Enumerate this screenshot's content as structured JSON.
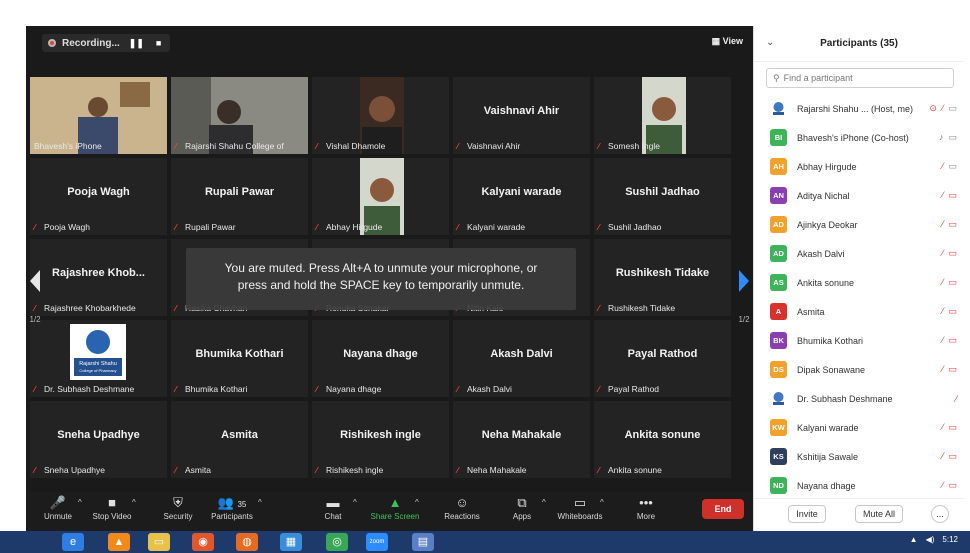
{
  "recording": {
    "label": "Recording...",
    "pause_glyph": "❚❚",
    "stop_glyph": "■"
  },
  "view_label": "View",
  "tiles": [
    {
      "big": "",
      "cap": "Bhavesh's iPhone",
      "photo": "man-room",
      "active": true,
      "muted": false
    },
    {
      "big": "",
      "cap": "Rajarshi Shahu College of",
      "photo": "man-dark",
      "active": false,
      "muted": true
    },
    {
      "big": "",
      "cap": "Vishal Dhamole",
      "photo": "face-dark",
      "active": false,
      "muted": true
    },
    {
      "big": "Vaishnavi Ahir",
      "cap": "Vaishnavi Ahir",
      "photo": "",
      "active": false,
      "muted": true
    },
    {
      "big": "",
      "cap": "Somesh Ingle",
      "photo": "face-light",
      "active": false,
      "muted": true
    },
    {
      "big": "Pooja Wagh",
      "cap": "Pooja Wagh",
      "photo": "",
      "active": false,
      "muted": true
    },
    {
      "big": "Rupali Pawar",
      "cap": "Rupali Pawar",
      "photo": "",
      "active": false,
      "muted": true
    },
    {
      "big": "",
      "cap": "Abhay Hirgude",
      "photo": "face-light",
      "active": false,
      "muted": true
    },
    {
      "big": "Kalyani warade",
      "cap": "Kalyani warade",
      "photo": "",
      "active": false,
      "muted": true
    },
    {
      "big": "Sushil Jadhao",
      "cap": "Sushil Jadhao",
      "photo": "",
      "active": false,
      "muted": true
    },
    {
      "big": "Rajashree Khob...",
      "cap": "Rajashree Khobarkhede",
      "photo": "",
      "active": false,
      "muted": true
    },
    {
      "big": "",
      "cap": "Rasika Chavhan",
      "photo": "",
      "active": false,
      "muted": true
    },
    {
      "big": "",
      "cap": "Renuka Sonakar",
      "photo": "",
      "active": false,
      "muted": true
    },
    {
      "big": "",
      "cap": "Nitin Kale",
      "photo": "",
      "active": false,
      "muted": true
    },
    {
      "big": "Rushikesh Tidake",
      "cap": "Rushikesh Tidake",
      "photo": "",
      "active": false,
      "muted": true
    },
    {
      "big": "",
      "cap": "Dr. Subhash Deshmane",
      "photo": "logo",
      "active": false,
      "muted": true
    },
    {
      "big": "Bhumika Kothari",
      "cap": "Bhumika Kothari",
      "photo": "",
      "active": false,
      "muted": true
    },
    {
      "big": "Nayana dhage",
      "cap": "Nayana dhage",
      "photo": "",
      "active": false,
      "muted": true
    },
    {
      "big": "Akash Dalvi",
      "cap": "Akash Dalvi",
      "photo": "",
      "active": false,
      "muted": true
    },
    {
      "big": "Payal Rathod",
      "cap": "Payal Rathod",
      "photo": "",
      "active": false,
      "muted": true
    },
    {
      "big": "Sneha Upadhye",
      "cap": "Sneha Upadhye",
      "photo": "",
      "active": false,
      "muted": true
    },
    {
      "big": "Asmita",
      "cap": "Asmita",
      "photo": "",
      "active": false,
      "muted": true
    },
    {
      "big": "Rishikesh ingle",
      "cap": "Rishikesh ingle",
      "photo": "",
      "active": false,
      "muted": true
    },
    {
      "big": "Neha Mahakale",
      "cap": "Neha Mahakale",
      "photo": "",
      "active": false,
      "muted": true
    },
    {
      "big": "Ankita sonune",
      "cap": "Ankita sonune",
      "photo": "",
      "active": false,
      "muted": true
    }
  ],
  "logo_text": {
    "line1": "Rajarshi Shahu",
    "line2": "College of Pharmacy"
  },
  "page_indicator": "1/2",
  "toast": {
    "line1": "You are muted. Press Alt+A to unmute your microphone, or",
    "line2": "press and hold the SPACE key to temporarily unmute."
  },
  "toolbar": {
    "items": [
      {
        "label": "Unmute",
        "icon": "mic-muted-icon",
        "glyph": "🎤",
        "caret": true
      },
      {
        "label": "Stop Video",
        "icon": "video-icon",
        "glyph": "■",
        "caret": true
      },
      {
        "label": "Security",
        "icon": "shield-icon",
        "glyph": "⛨",
        "caret": false
      },
      {
        "label": "Participants",
        "icon": "participants-icon",
        "glyph": "👥",
        "caret": true,
        "count": "35"
      },
      {
        "label": "Chat",
        "icon": "chat-icon",
        "glyph": "▬",
        "caret": true
      },
      {
        "label": "Share Screen",
        "icon": "share-screen-icon",
        "glyph": "▲",
        "caret": true
      },
      {
        "label": "Reactions",
        "icon": "reactions-icon",
        "glyph": "☺",
        "caret": false
      },
      {
        "label": "Apps",
        "icon": "apps-icon",
        "glyph": "⧉",
        "caret": true
      },
      {
        "label": "Whiteboards",
        "icon": "whiteboard-icon",
        "glyph": "▭",
        "caret": true
      },
      {
        "label": "More",
        "icon": "more-icon",
        "glyph": "•••",
        "caret": false
      }
    ],
    "end_label": "End"
  },
  "panel": {
    "title": "Participants (35)",
    "search_placeholder": "Find a participant",
    "participants": [
      {
        "name": "Rajarshi Shahu ... (Host, me)",
        "initials": "",
        "color": "",
        "logo": true,
        "mic": "off",
        "video": "on",
        "extra": "⊙"
      },
      {
        "name": "Bhavesh's iPhone (Co-host)",
        "initials": "BI",
        "color": "#3eb35a",
        "logo": false,
        "mic": "on",
        "video": "on",
        "extra": ""
      },
      {
        "name": "Abhay Hirgude",
        "initials": "AH",
        "color": "#f0a22a",
        "logo": false,
        "mic": "off",
        "video": "on",
        "extra": ""
      },
      {
        "name": "Aditya Nichal",
        "initials": "AN",
        "color": "#8a3fb0",
        "logo": false,
        "mic": "off",
        "video": "off",
        "extra": ""
      },
      {
        "name": "Ajinkya Deokar",
        "initials": "AD",
        "color": "#f0a22a",
        "logo": false,
        "mic": "off",
        "video": "off",
        "extra": ""
      },
      {
        "name": "Akash Dalvi",
        "initials": "AD",
        "color": "#3eb35a",
        "logo": false,
        "mic": "off",
        "video": "off",
        "extra": ""
      },
      {
        "name": "Ankita sonune",
        "initials": "AS",
        "color": "#3eb35a",
        "logo": false,
        "mic": "off",
        "video": "off",
        "extra": ""
      },
      {
        "name": "Asmita",
        "initials": "A",
        "color": "#d8322c",
        "logo": false,
        "mic": "off",
        "video": "off",
        "extra": ""
      },
      {
        "name": "Bhumika Kothari",
        "initials": "BK",
        "color": "#8a3fb0",
        "logo": false,
        "mic": "off",
        "video": "off",
        "extra": ""
      },
      {
        "name": "Dipak Sonawane",
        "initials": "DS",
        "color": "#f0a22a",
        "logo": false,
        "mic": "off",
        "video": "off",
        "extra": ""
      },
      {
        "name": "Dr. Subhash Deshmane",
        "initials": "",
        "color": "",
        "logo": true,
        "mic": "off",
        "video": "none",
        "extra": ""
      },
      {
        "name": "Kalyani warade",
        "initials": "KW",
        "color": "#f0a22a",
        "logo": false,
        "mic": "off",
        "video": "off",
        "extra": ""
      },
      {
        "name": "Kshitija Sawale",
        "initials": "KS",
        "color": "#2d3f5a",
        "logo": false,
        "mic": "off",
        "video": "off",
        "extra": ""
      },
      {
        "name": "Nayana dhage",
        "initials": "ND",
        "color": "#3eb35a",
        "logo": false,
        "mic": "off",
        "video": "off",
        "extra": ""
      }
    ],
    "invite_label": "Invite",
    "mute_all_label": "Mute All",
    "more_label": "..."
  },
  "taskbar": {
    "apps": [
      {
        "name": "edge-icon",
        "glyph": "e",
        "color": "#2f7de1"
      },
      {
        "name": "vlc-icon",
        "glyph": "▲",
        "color": "#f28a1a"
      },
      {
        "name": "file-explorer-icon",
        "glyph": "▭",
        "color": "#e9c04a"
      },
      {
        "name": "media-player-icon",
        "glyph": "◉",
        "color": "#e2572a"
      },
      {
        "name": "firefox-icon",
        "glyph": "◍",
        "color": "#e66a1f"
      },
      {
        "name": "photos-icon",
        "glyph": "▦",
        "color": "#3a8dd8"
      },
      {
        "name": "chrome-icon",
        "glyph": "◎",
        "color": "#3aa757"
      },
      {
        "name": "zoom-icon",
        "glyph": "zoom",
        "color": "#2d8cff"
      },
      {
        "name": "powerpoint-icon",
        "glyph": "▤",
        "color": "#5b7fc7"
      }
    ],
    "time": "5:12"
  }
}
